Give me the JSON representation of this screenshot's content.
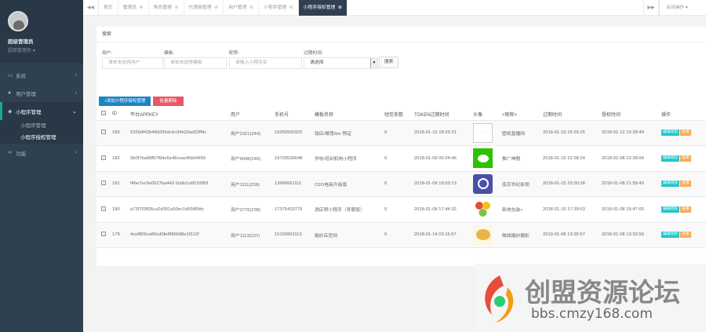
{
  "sidebar": {
    "user_name": "超级管理员",
    "user_role": "超级管理员",
    "items": [
      {
        "label": "系统",
        "icon": "monitor-icon"
      },
      {
        "label": "用户管理",
        "icon": "user-icon"
      },
      {
        "label": "小程序管理",
        "icon": "chat-icon",
        "sub": [
          "小程序管理",
          "小程序授权管理"
        ]
      },
      {
        "label": "功能",
        "icon": "link-icon"
      }
    ]
  },
  "tabs": [
    {
      "label": "首页"
    },
    {
      "label": "管理员"
    },
    {
      "label": "角色管理"
    },
    {
      "label": "代理商管理"
    },
    {
      "label": "用户管理"
    },
    {
      "label": "小程序管理"
    },
    {
      "label": "小程序授权管理",
      "active": true
    }
  ],
  "close_ops": "关闭操作",
  "search": {
    "title": "搜索",
    "user_label": "用户:",
    "user_placeholder": "请单击选择用户",
    "template_label": "模板:",
    "template_placeholder": "请单击选择模板",
    "name_label": "昵称:",
    "name_placeholder": "请输入小程序名",
    "expire_label": "过期时间:",
    "expire_value": "请选择",
    "search_button": "搜索"
  },
  "toolbar": {
    "add_label": "+添加小程序授权管理",
    "delete_label": "批量删除"
  },
  "table": {
    "headers": [
      "ID",
      "平台APPKEY",
      "用户",
      "手机号",
      "模板名称",
      "短信条数",
      "TOKEN过期时间",
      "头像",
      "<昵称>",
      "过期时间",
      "授权时间",
      "操作"
    ],
    "rows": [
      {
        "id": "183",
        "appkey": "6359df42b48d296dc6c94b33ad32ff9c",
        "user": "用户2321(244)",
        "phone": "15050930325",
        "template": "钱店/餐馆/ktv 预定",
        "sms": "0",
        "token_exp": "2018-01-12 18:25:31",
        "nickname": "壁纸直播网",
        "expire": "2018-01-19 16:29:25",
        "auth": "2018-01-12 16:28:49"
      },
      {
        "id": "182",
        "appkey": "2b0f7ba68f57f94e5e46ceacf6b04659",
        "user": "用户9048(240)",
        "phone": "15703539048",
        "template": "学校/培训机构小程序",
        "sms": "0",
        "token_exp": "2018-01-09 00:24:46",
        "nickname": "推广神器",
        "expire": "2018-01-15 22:28:24",
        "auth": "2018-01-08 22:28:04"
      },
      {
        "id": "181",
        "appkey": "f46e7ec6e0627ba443 0cbb1cdf19390f",
        "user": "用户1111(239)",
        "phone": "13666661111",
        "template": "O2O电商升级版",
        "sms": "0",
        "token_exp": "2018-01-09 16:53:13",
        "nickname": "南京世纪影视",
        "expire": "2018-01-15 22:00:28",
        "auth": "2018-01-08 21:59:49"
      },
      {
        "id": "180",
        "appkey": "a72f769f26ca2d301a50ec1d55f80dc",
        "user": "用户3776(238)",
        "phone": "17375433776",
        "template": "酒店预小程序（育婴版）",
        "sms": "0",
        "token_exp": "2018-01-08 17:44:32",
        "nickname": "新地包装+",
        "expire": "2018-01-15 17:39:53",
        "auth": "2018-01-08 15:47:05"
      },
      {
        "id": "179",
        "appkey": "4cef809ca80cd0fe8f96698e1f312f",
        "user": "用户1113(237)",
        "phone": "15169991113",
        "template": "婚纱店官网",
        "sms": "0",
        "token_exp": "2018-01-14 03:16:57",
        "nickname": "微城婚纱摄影",
        "expire": "2019-01-08 13:35:57",
        "auth": "2018-01-08 13:33:59"
      }
    ],
    "edit_label": "编辑授权",
    "view_label": "查看"
  },
  "watermark": {
    "title": "创盟资源论坛",
    "url": "bbs.cmzy168.com"
  },
  "colors": {
    "sidebar": "#2f4050",
    "add_button": "#1c84c6",
    "delete_button": "#ed5565",
    "edit_badge": "#23c6c8",
    "view_badge": "#f8ac59"
  }
}
